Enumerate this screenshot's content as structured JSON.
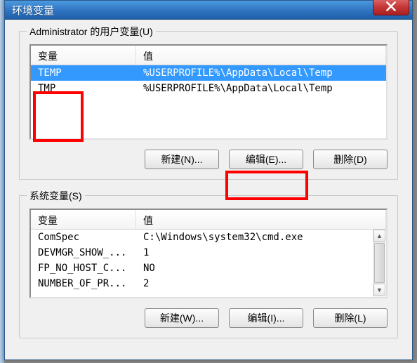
{
  "window": {
    "title": "环境变量"
  },
  "user_section": {
    "label": "Administrator 的用户变量(U)",
    "columns": {
      "var": "变量",
      "val": "值"
    },
    "rows": [
      {
        "var": "TEMP",
        "val": "%USERPROFILE%\\AppData\\Local\\Temp",
        "selected": true
      },
      {
        "var": "TMP",
        "val": "%USERPROFILE%\\AppData\\Local\\Temp",
        "selected": false
      }
    ],
    "buttons": {
      "new": "新建(N)...",
      "edit": "编辑(E)...",
      "delete": "删除(D)"
    }
  },
  "sys_section": {
    "label": "系统变量(S)",
    "columns": {
      "var": "变量",
      "val": "值"
    },
    "rows": [
      {
        "var": "ComSpec",
        "val": "C:\\Windows\\system32\\cmd.exe"
      },
      {
        "var": "DEVMGR_SHOW_...",
        "val": "1"
      },
      {
        "var": "FP_NO_HOST_C...",
        "val": "NO"
      },
      {
        "var": "NUMBER_OF_PR...",
        "val": "2"
      }
    ],
    "buttons": {
      "new": "新建(W)...",
      "edit": "编辑(I)...",
      "delete": "删除(L)"
    }
  }
}
